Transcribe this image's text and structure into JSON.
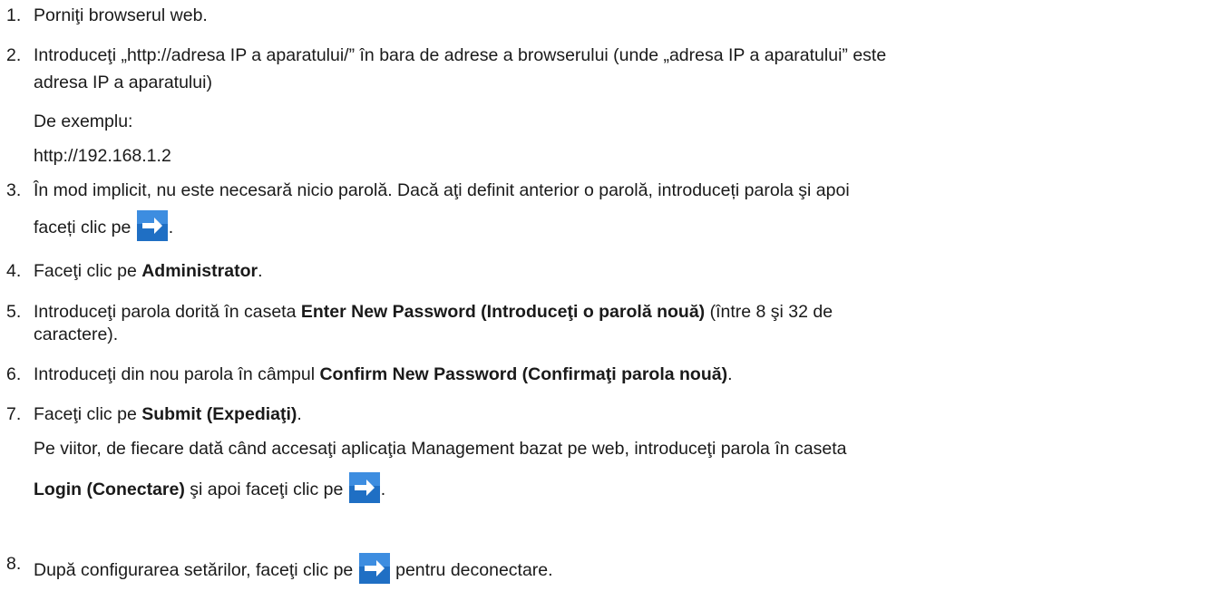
{
  "steps": [
    {
      "num": "1.",
      "text": "Porniţi browserul web."
    },
    {
      "num": "2.",
      "line1": "Introduceţi „http://adresa IP a aparatului/” în bara de adrese a browserului (unde „adresa IP a aparatului” este",
      "line2": "adresa IP a aparatului)",
      "example_label": "De exemplu:",
      "example_url": "http://192.168.1.2"
    },
    {
      "num": "3.",
      "line1": "În mod implicit, nu este necesară nicio parolă. Dacă aţi definit anterior o parolă, introduceți parola şi apoi",
      "line2_before": "faceți clic pe",
      "line2_after": "."
    },
    {
      "num": "4.",
      "before": "Faceţi clic pe ",
      "bold": "Administrator",
      "after": "."
    },
    {
      "num": "5.",
      "before": "Introduceţi parola dorită în caseta ",
      "bold": "Enter New Password (Introduceţi o parolă nouă)",
      "after": " (între 8 şi 32 de",
      "line2": "caractere)."
    },
    {
      "num": "6.",
      "before": "Introduceţi din nou parola în câmpul ",
      "bold": "Confirm New Password (Confirmaţi parola nouă)",
      "after": "."
    },
    {
      "num": "7.",
      "before": "Faceţi clic pe ",
      "bold": "Submit (Expediaţi)",
      "after": ".",
      "note_line1": "Pe viitor, de fiecare dată când accesaţi aplicaţia Management bazat pe web, introduceţi parola în caseta",
      "note_bold": "Login (Conectare)",
      "note_after": " şi apoi faceţi clic pe ",
      "note_end": "."
    },
    {
      "num": "8.",
      "before": "După configurarea setărilor, faceţi clic pe ",
      "after": " pentru deconectare."
    }
  ],
  "icons": {
    "arrow": "arrow-right-icon",
    "arrow_bg": "#1f6fc4",
    "arrow_fg": "#ffffff"
  }
}
